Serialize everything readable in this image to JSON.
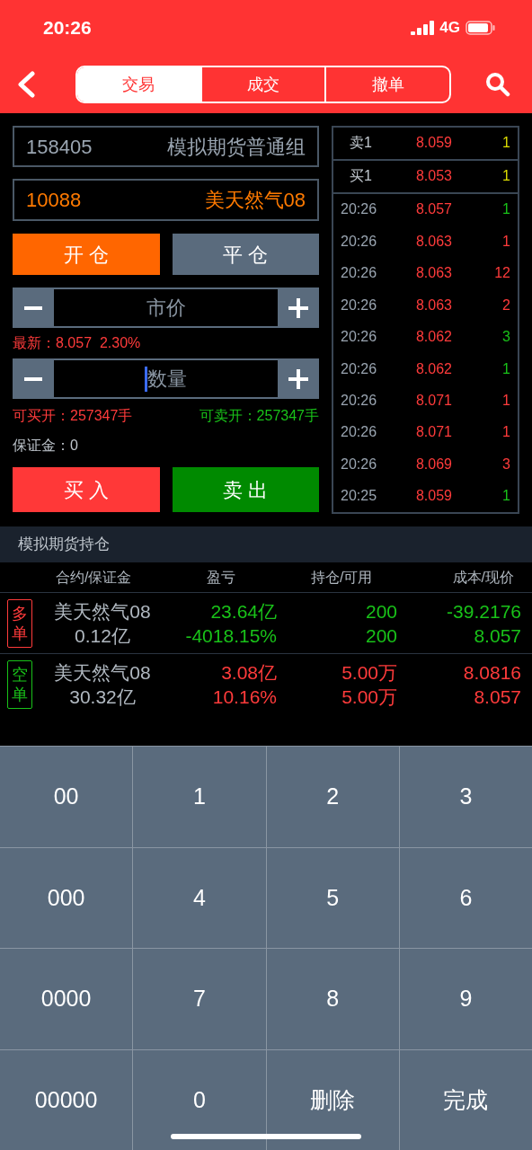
{
  "status_bar": {
    "time": "20:26",
    "network": "4G"
  },
  "tabs": [
    {
      "label": "交易",
      "selected": true
    },
    {
      "label": "成交",
      "selected": false
    },
    {
      "label": "撤单",
      "selected": false
    }
  ],
  "account": {
    "id": "158405",
    "group": "模拟期货普通组"
  },
  "contract": {
    "code": "10088",
    "name": "美天然气08"
  },
  "mode_buttons": [
    {
      "label": "开 仓",
      "selected": true
    },
    {
      "label": "平 仓",
      "selected": false
    }
  ],
  "price_field": {
    "placeholder": "市价"
  },
  "latest": "最新：8.057  2.30%",
  "quantity_field": {
    "placeholder": "数量",
    "focused": true
  },
  "can_buy": "可买开：257347手",
  "can_sell": "可卖开：257347手",
  "margin": "保证金：0",
  "actions": [
    {
      "label": "买 入",
      "kind": "buy"
    },
    {
      "label": "卖 出",
      "kind": "sell"
    }
  ],
  "quotes": [
    {
      "label": "卖1",
      "price": "8.059",
      "volume": "1",
      "color": "#dcdc00"
    },
    {
      "label": "买1",
      "price": "8.053",
      "volume": "1",
      "color": "#dcdc00"
    }
  ],
  "trades": [
    {
      "time": "20:26",
      "price": "8.057",
      "volume": "1",
      "color": "#19c219"
    },
    {
      "time": "20:26",
      "price": "8.063",
      "volume": "1",
      "color": "#ff3b3b"
    },
    {
      "time": "20:26",
      "price": "8.063",
      "volume": "12",
      "color": "#ff3b3b"
    },
    {
      "time": "20:26",
      "price": "8.063",
      "volume": "2",
      "color": "#ff3b3b"
    },
    {
      "time": "20:26",
      "price": "8.062",
      "volume": "3",
      "color": "#19c219"
    },
    {
      "time": "20:26",
      "price": "8.062",
      "volume": "1",
      "color": "#19c219"
    },
    {
      "time": "20:26",
      "price": "8.071",
      "volume": "1",
      "color": "#ff3b3b"
    },
    {
      "time": "20:26",
      "price": "8.071",
      "volume": "1",
      "color": "#ff3b3b"
    },
    {
      "time": "20:26",
      "price": "8.069",
      "volume": "3",
      "color": "#ff3b3b"
    },
    {
      "time": "20:25",
      "price": "8.059",
      "volume": "1",
      "color": "#19c219"
    }
  ],
  "positions": {
    "title": "模拟期货持仓",
    "columns": [
      "合约/保证金",
      "盈亏",
      "持仓/可用",
      "成本/现价"
    ],
    "rows": [
      {
        "side": {
          "label": "多单",
          "color": "#ff3b3b"
        },
        "contract": "美天然气08",
        "margin": "0.12亿",
        "pnl": "23.64亿",
        "pnl_pct": "-4018.15%",
        "hold": "200",
        "avail": "200",
        "cost": "-39.2176",
        "price": "8.057",
        "color": "#19c219"
      },
      {
        "side": {
          "label": "空单",
          "color": "#19c219"
        },
        "contract": "美天然气08",
        "margin": "30.32亿",
        "pnl": "3.08亿",
        "pnl_pct": "10.16%",
        "hold": "5.00万",
        "avail": "5.00万",
        "cost": "8.0816",
        "price": "8.057",
        "color": "#ff3b3b"
      }
    ]
  },
  "keypad": [
    "00",
    "1",
    "2",
    "3",
    "000",
    "4",
    "5",
    "6",
    "0000",
    "7",
    "8",
    "9",
    "00000",
    "0",
    "删除",
    "完成"
  ]
}
